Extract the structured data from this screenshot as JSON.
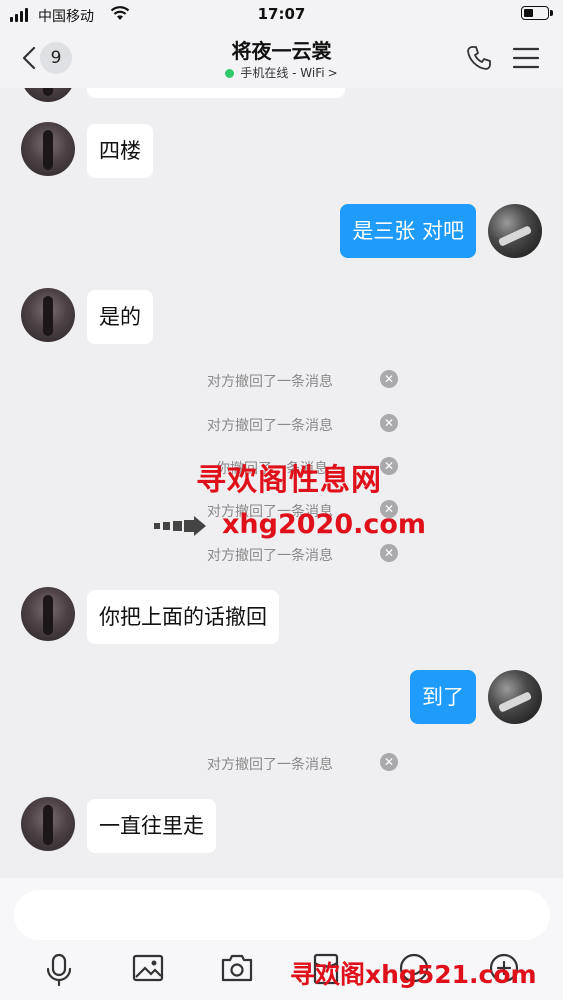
{
  "status_bar": {
    "carrier": "中国移动",
    "time": "17:07"
  },
  "header": {
    "back_badge": "9",
    "title": "将夜一云裳",
    "status": "手机在线 - WiFi",
    "status_chevron": ">"
  },
  "messages": [
    {
      "side": "in",
      "text": "四楼"
    },
    {
      "side": "out",
      "text": "是三张 对吧"
    },
    {
      "side": "in",
      "text": "是的"
    },
    {
      "recall": "对方撤回了一条消息"
    },
    {
      "recall": "对方撤回了一条消息"
    },
    {
      "recall": "你撤回了一条消息"
    },
    {
      "recall": "对方撤回了一条消息"
    },
    {
      "recall": "对方撤回了一条消息"
    },
    {
      "side": "in",
      "text": "你把上面的话撤回"
    },
    {
      "side": "out",
      "text": "到了"
    },
    {
      "recall": "对方撤回了一条消息"
    },
    {
      "side": "in",
      "text": "一直往里走"
    }
  ],
  "watermark": {
    "title": "寻欢阁性息网",
    "url": "xhg2020.com",
    "bottom": "寻欢阁xhg521.com"
  },
  "toolbar_icons": [
    "microphone-icon",
    "image-icon",
    "camera-icon",
    "red-packet-icon",
    "emoji-icon",
    "plus-icon"
  ],
  "colors": {
    "bubble_out": "#1e9bfb",
    "online_dot": "#2fc86a",
    "watermark_red": "#e0101b"
  }
}
